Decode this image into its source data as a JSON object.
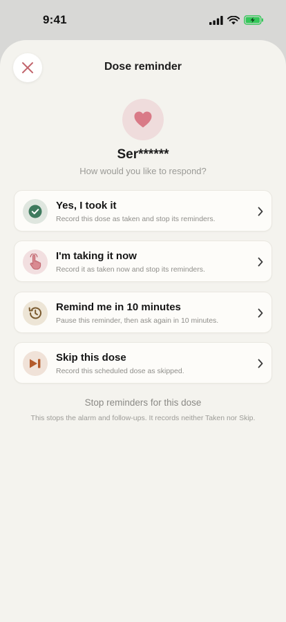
{
  "status_bar": {
    "time": "9:41"
  },
  "sheet": {
    "title": "Dose reminder",
    "medication_name": "Ser******",
    "prompt": "How would you like to respond?"
  },
  "options": [
    {
      "title": "Yes, I took it",
      "subtitle": "Record this dose as taken and stop its reminders.",
      "icon": "check-icon",
      "color": "#3f7a5e"
    },
    {
      "title": "I'm taking it now",
      "subtitle": "Record it as taken now and stop its reminders.",
      "icon": "hand-pointer-icon",
      "color": "#c0676f"
    },
    {
      "title": "Remind me in 10 minutes",
      "subtitle": "Pause this reminder, then ask again in 10 minutes.",
      "icon": "history-icon",
      "color": "#7a5a2f"
    },
    {
      "title": "Skip this dose",
      "subtitle": "Record this scheduled dose as skipped.",
      "icon": "skip-forward-icon",
      "color": "#b35a2a"
    }
  ],
  "stop_reminders": {
    "label": "Stop reminders for this dose",
    "description": "This stops the alarm and follow-ups. It records neither Taken nor Skip."
  },
  "colors": {
    "sheet_bg": "#f4f3ee",
    "close_icon": "#c2656d",
    "heart": "#d97a87",
    "battery": "#34c759"
  }
}
